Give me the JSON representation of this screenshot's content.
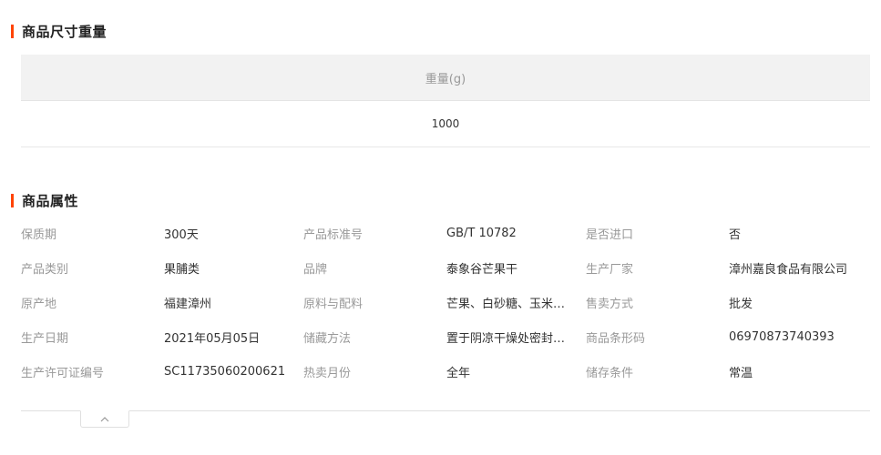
{
  "size_section": {
    "title": "商品尺寸重量",
    "header": "重量(g)",
    "value": "1000"
  },
  "attr_section": {
    "title": "商品属性",
    "rows": [
      [
        {
          "label": "保质期",
          "value": "300天"
        },
        {
          "label": "产品标准号",
          "value": "GB/T 10782"
        },
        {
          "label": "是否进口",
          "value": "否"
        }
      ],
      [
        {
          "label": "产品类别",
          "value": "果脯类"
        },
        {
          "label": "品牌",
          "value": "泰象谷芒果干"
        },
        {
          "label": "生产厂家",
          "value": "漳州嘉良食品有限公司"
        }
      ],
      [
        {
          "label": "原产地",
          "value": "福建漳州"
        },
        {
          "label": "原料与配料",
          "value": "芒果、白砂糖、玉米…"
        },
        {
          "label": "售卖方式",
          "value": "批发"
        }
      ],
      [
        {
          "label": "生产日期",
          "value": "2021年05月05日"
        },
        {
          "label": "储藏方法",
          "value": "置于阴凉干燥处密封…"
        },
        {
          "label": "商品条形码",
          "value": "06970873740393"
        }
      ],
      [
        {
          "label": "生产许可证编号",
          "value": "SC11735060200621"
        },
        {
          "label": "热卖月份",
          "value": "全年"
        },
        {
          "label": "储存条件",
          "value": "常温"
        }
      ]
    ]
  },
  "collapse": {
    "icon": "chevron-up-icon"
  },
  "colors": {
    "accent": "#ff4400",
    "label": "#999999",
    "value": "#333333",
    "header_bg": "#f2f2f2"
  }
}
